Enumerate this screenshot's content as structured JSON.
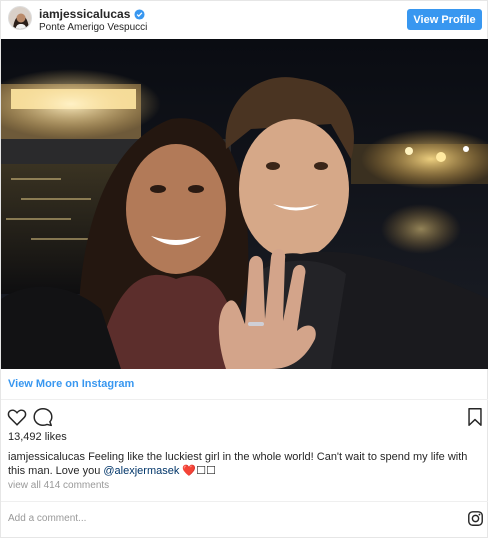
{
  "header": {
    "username": "iamjessicalucas",
    "location": "Ponte Amerigo Vespucci",
    "view_profile_label": "View Profile",
    "accent_color": "#3897f0"
  },
  "post": {
    "image_alt": "Couple selfie at night on a bridge, woman showing engagement ring",
    "view_more_label": "View More on Instagram",
    "likes": "13,492 likes",
    "caption": {
      "username": "iamjessicalucas",
      "text_before": " Feeling like the luckiest girl in the whole world! Can't wait to spend my life with this man. Love you ",
      "mention": "@alexjermasek",
      "text_after": " ❤️☐☐"
    },
    "comments_link": "view all 414 comments"
  },
  "comment_bar": {
    "placeholder": "Add a comment..."
  },
  "icons": {
    "verified": "verified-badge-icon",
    "like": "heart-icon",
    "comment": "comment-icon",
    "save": "bookmark-icon",
    "brand": "instagram-icon"
  }
}
